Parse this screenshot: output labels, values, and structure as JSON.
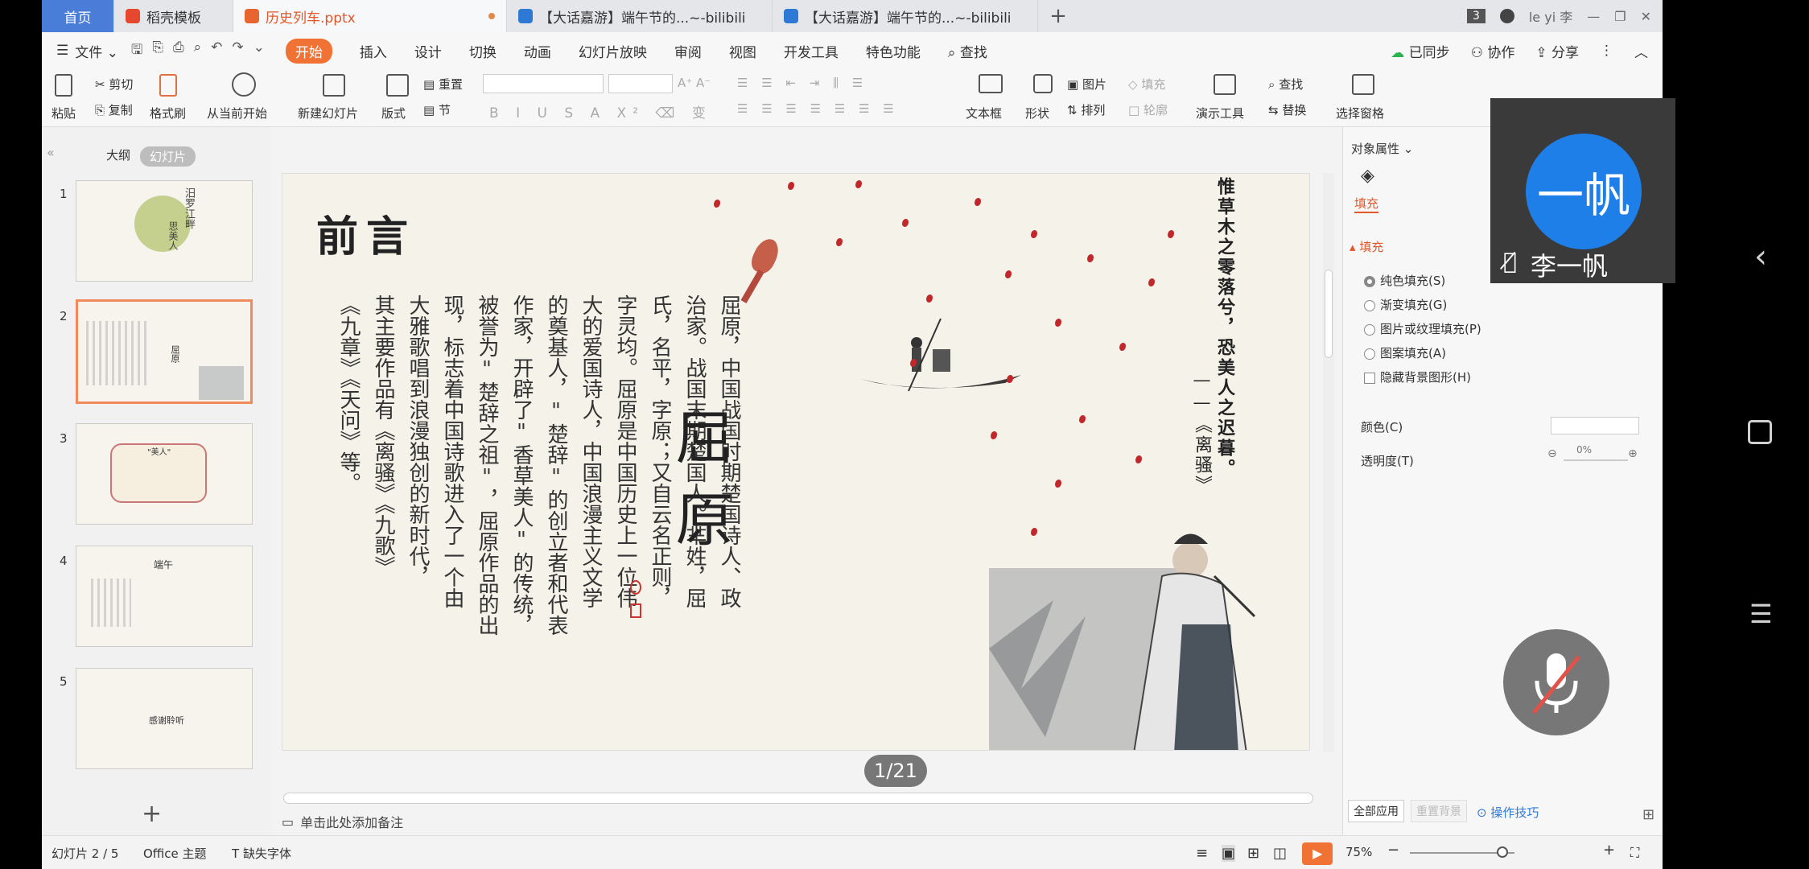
{
  "tabs": [
    {
      "label": "首页"
    },
    {
      "label": "稻壳模板"
    },
    {
      "label": "历史列车.pptx"
    },
    {
      "label": "【大话嘉游】端午节的...~-bilibili"
    },
    {
      "label": "【大话嘉游】端午节的...~-bilibili"
    }
  ],
  "window": {
    "badge": "3",
    "user": "le yi 李"
  },
  "menu": {
    "file": "文件",
    "items": [
      "开始",
      "插入",
      "设计",
      "切换",
      "动画",
      "幻灯片放映",
      "审阅",
      "视图",
      "开发工具",
      "特色功能"
    ],
    "search": "查找",
    "right": [
      "已同步",
      "协作",
      "分享"
    ]
  },
  "ribbon": {
    "paste": "粘贴",
    "cut": "剪切",
    "copy": "复制",
    "format_painter": "格式刷",
    "from_start": "从当前开始",
    "new_slide": "新建幻灯片",
    "layout": "版式",
    "reset": "重置",
    "section": "节",
    "textbox": "文本框",
    "shape": "形状",
    "picture": "图片",
    "fill": "填充",
    "arrange": "排列",
    "outline": "轮廓",
    "present_tools": "演示工具",
    "find": "查找",
    "replace": "替换",
    "select_pane": "选择窗格"
  },
  "left_panel": {
    "tab_outline": "大纲",
    "tab_slides": "幻灯片",
    "thumbs": [
      "1",
      "2",
      "3",
      "4",
      "5"
    ],
    "thumb_texts": [
      "汨罗江畔",
      "思美人",
      "屈原",
      "\"美人\"",
      "端午",
      "感谢聆听"
    ]
  },
  "slide": {
    "title": "前言",
    "columns": [
      "屈原，中国战国时期楚国诗人、政",
      "治家。战国末期楚国人。芈姓，屈",
      "氏，名平，字原；又自云名正则，",
      "字灵均。屈原是中国历史上一位伟",
      "大的爱国诗人，中国浪漫主义文学",
      "的奠基人，\"楚辞\"的创立者和代表",
      "作家，开辟了\"香草美人\"的传统，",
      "被誉为\"楚辞之祖\"，屈原作品的出",
      "现，标志着中国诗歌进入了一个由",
      "大雅歌唱到浪漫独创的新时代，",
      "其主要作品有《离骚》《九歌》",
      "《九章》《天问》等。"
    ],
    "name": "屈原",
    "poem_line": "惟草木之零落兮，恐美人之迟暮。",
    "poem_source": "——《离骚》"
  },
  "pager": "1/21",
  "notes_placeholder": "单击此处添加备注",
  "props": {
    "header": "对象属性",
    "tab_fill": "填充",
    "section": "填充",
    "options": [
      "纯色填充(S)",
      "渐变填充(G)",
      "图片或纹理填充(P)",
      "图案填充(A)"
    ],
    "hide_bg": "隐藏背景图形(H)",
    "color_label": "颜色(C)",
    "transparency_label": "透明度(T)",
    "transparency_value": "0%",
    "apply_all": "全部应用",
    "reset_bg": "重置背景",
    "tips": "操作技巧"
  },
  "status": {
    "slide_pos": "幻灯片 2 / 5",
    "theme": "Office 主题",
    "missing_font": "缺失字体",
    "zoom": "75%"
  },
  "video": {
    "avatar_text": "一帆",
    "name": "李一帆"
  },
  "colors": {
    "accent": "#f07335",
    "home_tab": "#4a7dd8",
    "avatar": "#1e7fe8",
    "petal": "#c2282b"
  }
}
